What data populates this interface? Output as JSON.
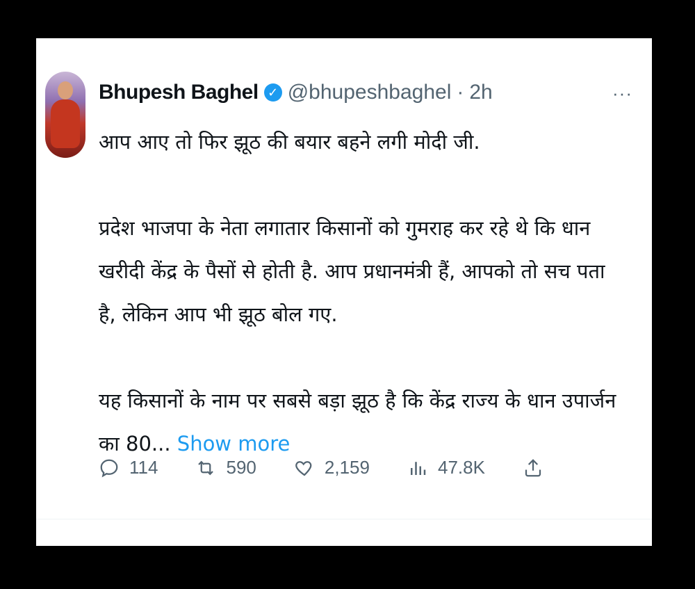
{
  "tweet": {
    "author_name": "Bhupesh Baghel",
    "handle": "@bhupeshbaghel",
    "separator": "·",
    "time": "2h",
    "more_label": "···",
    "paragraphs": [
      "आप आए तो फिर झूठ की बयार बहने लगी मोदी जी.",
      "प्रदेश भाजपा के नेता लगातार किसानों को गुमराह कर रहे थे कि धान खरीदी केंद्र के पैसों से होती है. आप प्रधानमंत्री हैं, आपको तो सच पता है, लेकिन आप भी झूठ बोल गए.",
      "यह किसानों के नाम पर सबसे बड़ा झूठ है कि केंद्र राज्य के धान उपार्जन का 80..."
    ],
    "show_more": "Show more"
  },
  "actions": {
    "replies": "114",
    "retweets": "590",
    "likes": "2,159",
    "views": "47.8K"
  },
  "icons": {
    "reply": "reply-icon",
    "retweet": "retweet-icon",
    "like": "heart-icon",
    "views": "analytics-icon",
    "share": "share-icon",
    "verified": "verified-badge-icon"
  },
  "colors": {
    "accent": "#1d9bf0",
    "text": "#0f1419",
    "muted": "#536471"
  }
}
